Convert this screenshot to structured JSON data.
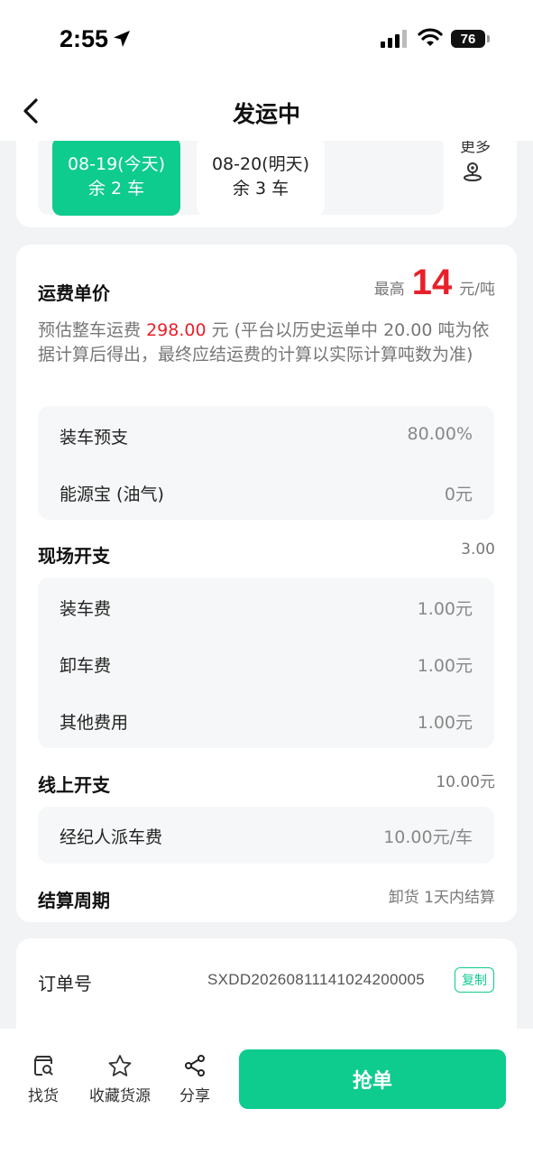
{
  "status_bar": {
    "time": "2:55",
    "battery": "76"
  },
  "nav": {
    "title": "发运中"
  },
  "dates": [
    {
      "date": "08-19(今天)",
      "remaining": "余 2 车",
      "active": true
    },
    {
      "date": "08-20(明天)",
      "remaining": "余 3 车",
      "active": false
    }
  ],
  "more_label": "更多",
  "freight": {
    "title": "运费单价",
    "price_prefix": "最高",
    "price": "14",
    "price_unit": "元/吨",
    "desc_prefix": "预估整车运费",
    "desc_amount": "298.00",
    "desc_suffix": "元 (平台以历史运单中 20.00 吨为依据计算后得出，最终应结运费的计算以实际计算吨数为准)"
  },
  "payment_items": [
    {
      "label": "装车预支",
      "value": "80.00%"
    },
    {
      "label": "能源宝 (油气)",
      "value": "0元"
    }
  ],
  "onsite": {
    "title": "现场开支",
    "total": "3.00",
    "items": [
      {
        "label": "装车费",
        "value": "1.00元"
      },
      {
        "label": "卸车费",
        "value": "1.00元"
      },
      {
        "label": "其他费用",
        "value": "1.00元"
      }
    ]
  },
  "online": {
    "title": "线上开支",
    "total": "10.00元",
    "items": [
      {
        "label": "经纪人派车费",
        "value": "10.00元/车"
      }
    ]
  },
  "settlement": {
    "title": "结算周期",
    "value": "卸货 1天内结算"
  },
  "order": {
    "label": "订单号",
    "number": "SXDD20260811141024200005",
    "copy_label": "复制"
  },
  "bottom_bar": {
    "find_goods": "找货",
    "favorite": "收藏货源",
    "share": "分享",
    "grab": "抢单"
  },
  "colors": {
    "accent": "#0ecb8e",
    "price_red": "#e8202a"
  }
}
